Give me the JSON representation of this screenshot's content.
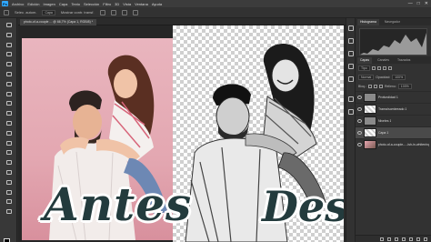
{
  "menubar": {
    "logo": "Ps",
    "items": [
      "Archivo",
      "Edición",
      "Imagen",
      "Capa",
      "Texto",
      "Selección",
      "Filtro",
      "3D",
      "Vista",
      "Ventana",
      "Ayuda"
    ],
    "window_controls": [
      "—",
      "□",
      "✕"
    ]
  },
  "optionsbar": {
    "tool_hint": "Selec. autom.",
    "layer_select": "Capa",
    "transform_label": "Mostrar contr. transf."
  },
  "document": {
    "tab_title": "photo-of-a-couple ... @ 66,7% (Capa 1, RGB/8) *"
  },
  "captions": {
    "before": "Antes",
    "after": "Despues"
  },
  "panels": {
    "top_tabs": [
      "Histograma",
      "Navegador"
    ],
    "layer_tabs": [
      "Capas",
      "Canales",
      "Trazados"
    ],
    "filter_label": "Tipo",
    "blend_mode": "Normal",
    "opacity_label": "Opacidad:",
    "opacity_value": "100%",
    "lock_label": "Bloq.:",
    "fill_label": "Relleno:",
    "fill_value": "100%"
  },
  "layers": [
    {
      "name": "Profundidad 1",
      "thumb": "gray",
      "selected": false
    },
    {
      "name": "Trama/sombreado 1",
      "thumb": "bw",
      "selected": false
    },
    {
      "name": "Niveles 1",
      "thumb": "gray",
      "selected": false
    },
    {
      "name": "Capa 1",
      "thumb": "bw",
      "selected": true
    },
    {
      "name": "photo-of-a-couple-...-lsh-in-whitening",
      "thumb": "photo",
      "selected": false
    }
  ],
  "colors": {
    "accent": "#31a8ff",
    "caption": "#233b3d",
    "before_background": "#e3a7b1"
  },
  "icons": {
    "toolbar": [
      "move-icon",
      "marquee-icon",
      "lasso-icon",
      "quick-select-icon",
      "crop-icon",
      "eyedropper-icon",
      "healing-icon",
      "brush-icon",
      "stamp-icon",
      "history-brush-icon",
      "eraser-icon",
      "gradient-icon",
      "blur-icon",
      "dodge-icon",
      "pen-icon",
      "type-icon",
      "path-select-icon",
      "shape-icon",
      "hand-icon",
      "zoom-icon"
    ]
  }
}
